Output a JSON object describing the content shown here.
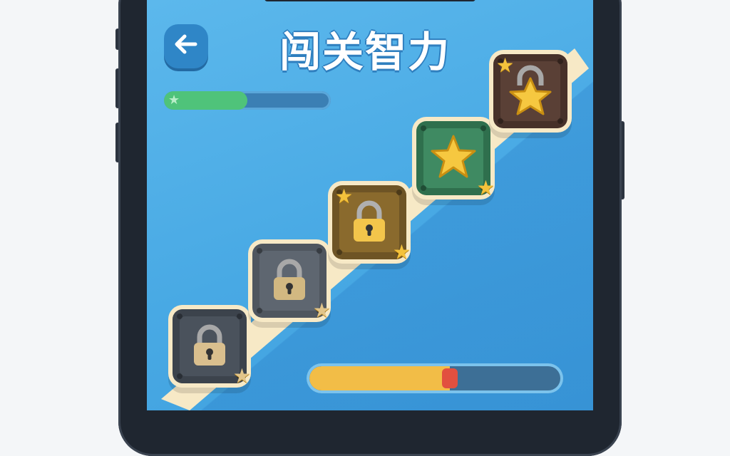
{
  "game": {
    "title": "闯关智力",
    "back_icon": "arrow-left-icon"
  },
  "hud": {
    "top_progress": {
      "fraction": 0.5,
      "icon": "star-icon",
      "fill_color": "#4fc37a"
    },
    "bottom_progress": {
      "fraction": 0.56,
      "marker_color": "#e2503f",
      "fill_color": "#f2bd47"
    }
  },
  "levels": [
    {
      "id": 1,
      "state": "locked",
      "icon": "padlock-icon",
      "tile_color": "#4a525c",
      "lock_color": "#d9bf8e",
      "corner_star": "bottom-right"
    },
    {
      "id": 2,
      "state": "locked",
      "icon": "padlock-icon",
      "tile_color": "#5e6670",
      "lock_color": "#d2b881",
      "corner_star": "bottom-right"
    },
    {
      "id": 3,
      "state": "locked",
      "icon": "padlock-icon",
      "tile_color": "#8a6a2d",
      "lock_color": "#f3c54b",
      "corner_star": "top-left+bottom-right"
    },
    {
      "id": 4,
      "state": "unlocked",
      "icon": "star-icon",
      "tile_color": "#3f8a62",
      "corner_star": "bottom-right"
    },
    {
      "id": 5,
      "state": "locked-star",
      "icon": "padlock-star-icon",
      "tile_color": "#5a4036",
      "corner_star": "top-left"
    }
  ]
}
